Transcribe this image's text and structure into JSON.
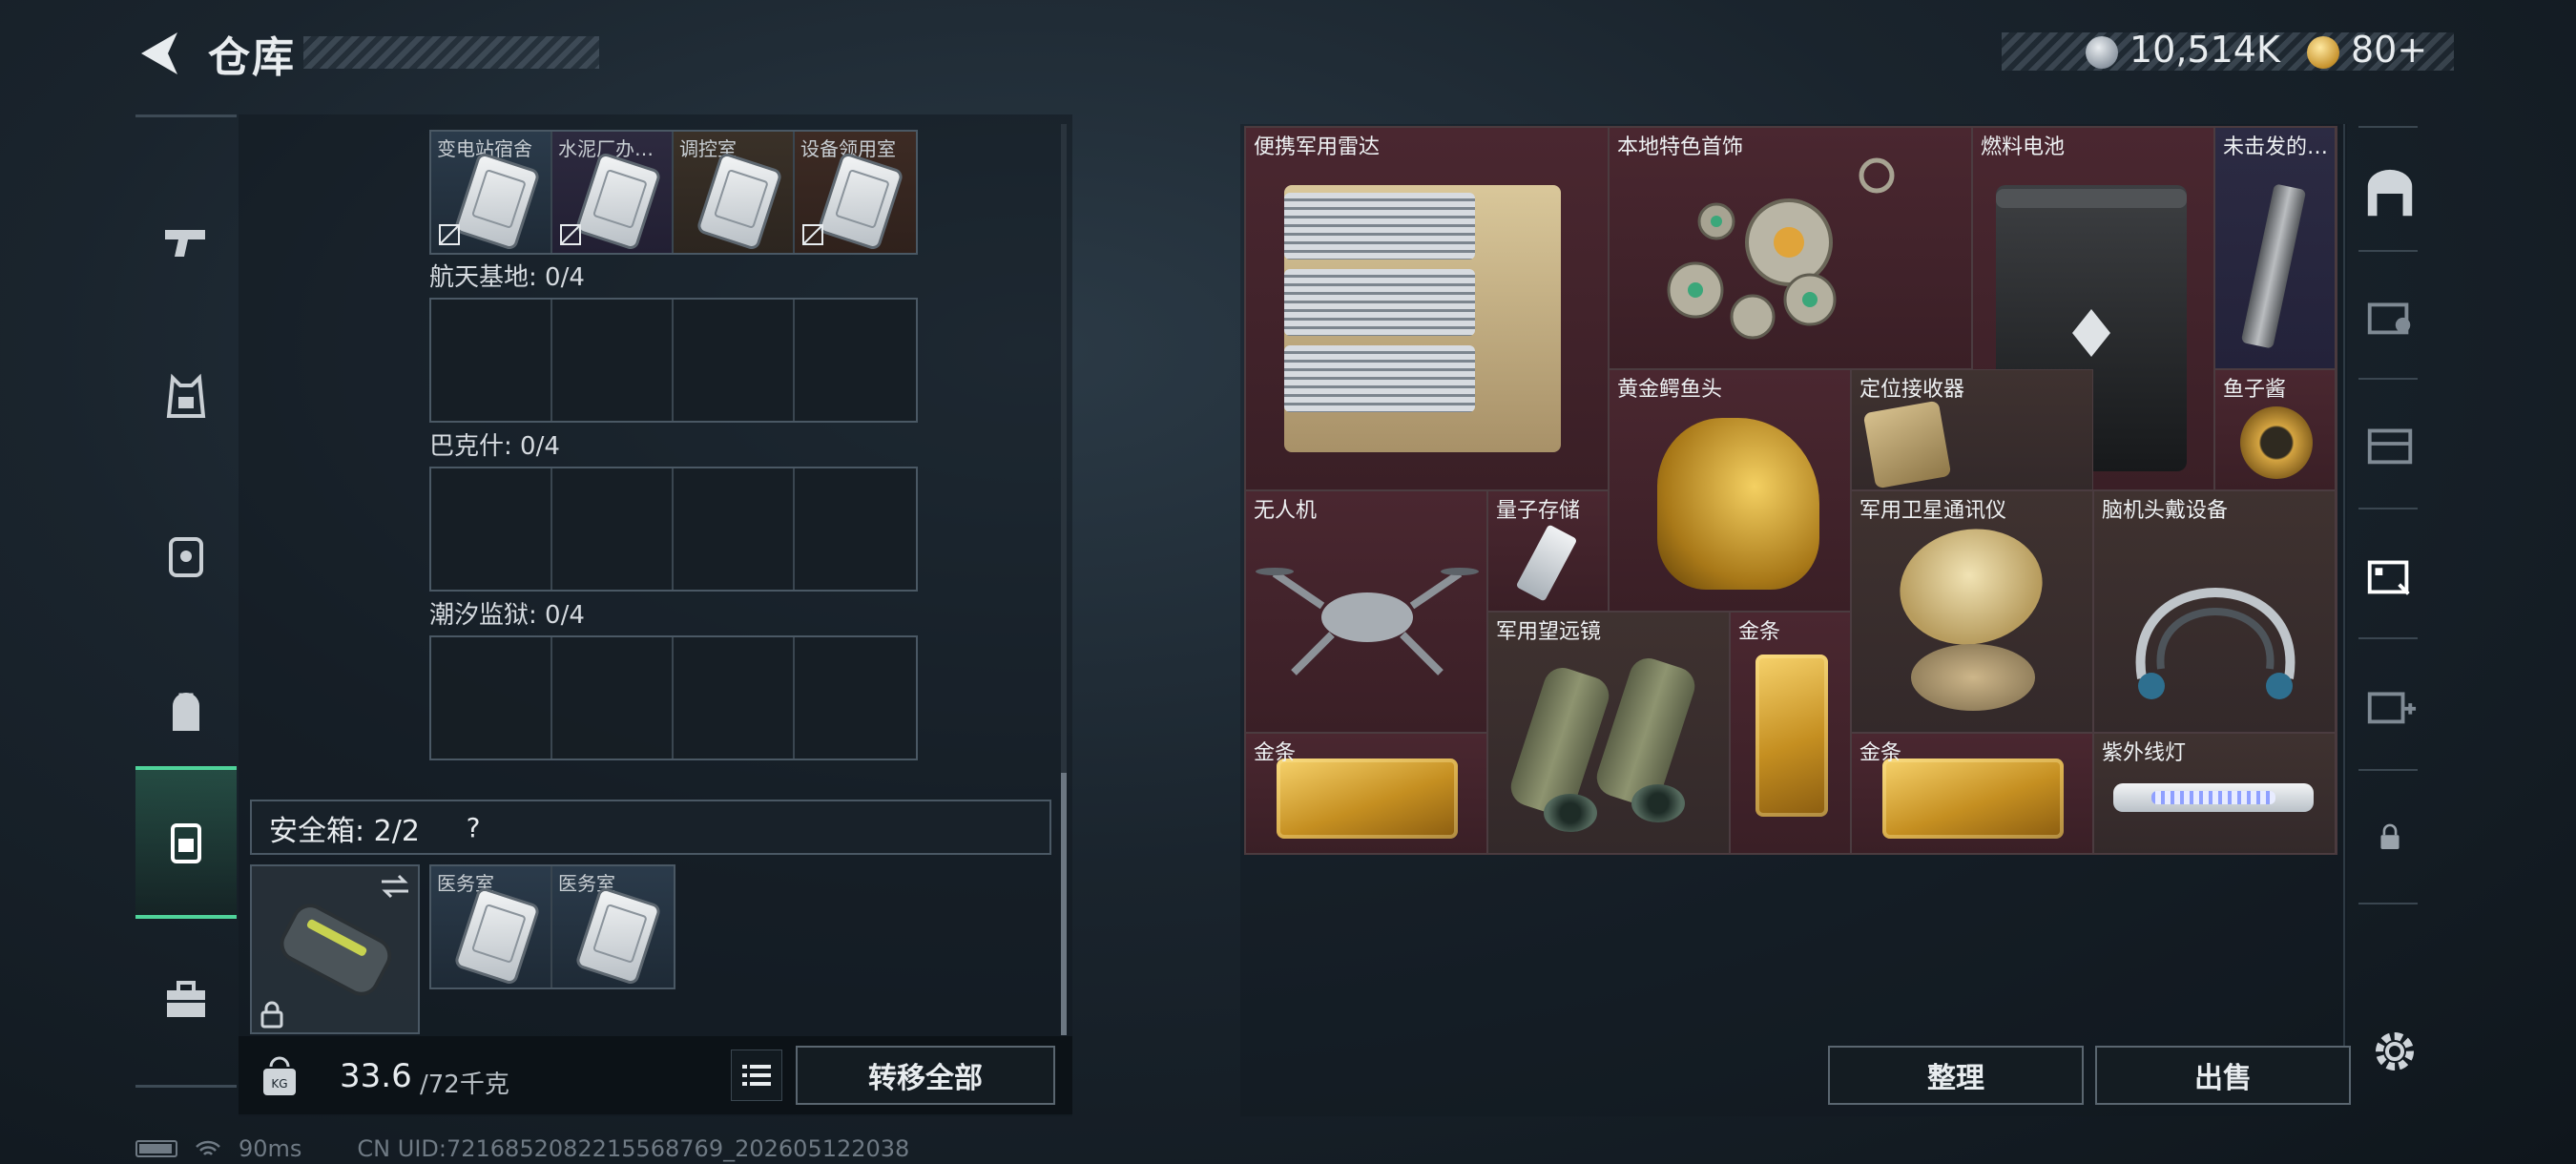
{
  "header": {
    "title": "仓库",
    "currency_silver": "10,514K",
    "currency_gold": "80+"
  },
  "sidebar": {
    "tabs": [
      {
        "name": "weapons",
        "icon": "pistol-icon"
      },
      {
        "name": "armor",
        "icon": "vest-icon"
      },
      {
        "name": "helmet",
        "icon": "chest-rig-icon"
      },
      {
        "name": "backpack",
        "icon": "backpack-icon"
      },
      {
        "name": "keys",
        "icon": "keycard-case-icon",
        "active": true
      },
      {
        "name": "containers",
        "icon": "briefcase-icon"
      }
    ]
  },
  "key_slots_top": [
    "变电站宿舍",
    "水泥厂办…",
    "调控室",
    "设备领用室"
  ],
  "maps": [
    {
      "label": "航天基地: 0/4"
    },
    {
      "label": "巴克什: 0/4"
    },
    {
      "label": "潮汐监狱: 0/4"
    }
  ],
  "secure": {
    "label": "安全箱: 2/2",
    "help": "?",
    "slots": [
      "医务室",
      "医务室"
    ]
  },
  "footer_left": {
    "weight_value": "33.6",
    "weight_max": "/72千克",
    "transfer_label": "转移全部"
  },
  "items": [
    {
      "name": "便携军用雷达",
      "rarity": "red"
    },
    {
      "name": "本地特色首饰",
      "rarity": "red"
    },
    {
      "name": "燃料电池",
      "rarity": "red"
    },
    {
      "name": "未击发的…",
      "rarity": "purple"
    },
    {
      "name": "黄金鳄鱼头",
      "rarity": "red"
    },
    {
      "name": "定位接收器",
      "rarity": "brown"
    },
    {
      "name": "鱼子酱",
      "rarity": "red"
    },
    {
      "name": "无人机",
      "rarity": "red"
    },
    {
      "name": "量子存储",
      "rarity": "red"
    },
    {
      "name": "军用卫星通讯仪",
      "rarity": "brown"
    },
    {
      "name": "脑机头戴设备",
      "rarity": "brown"
    },
    {
      "name": "军用望远镜",
      "rarity": "brown"
    },
    {
      "name": "金条",
      "rarity": "red"
    },
    {
      "name": "金条",
      "rarity": "red"
    },
    {
      "name": "金条",
      "rarity": "red"
    },
    {
      "name": "紫外线灯",
      "rarity": "brown"
    }
  ],
  "footer_right": {
    "sort_label": "整理",
    "sell_label": "出售"
  },
  "status_bar": {
    "ping": "90ms",
    "uid": "CN UID:7216852082215568769_202605122038"
  },
  "colors": {
    "accent_green": "#4fd39a",
    "rarity_red": "#4a2730",
    "rarity_purple": "#2c2b43",
    "rarity_brown": "#3f3230"
  }
}
